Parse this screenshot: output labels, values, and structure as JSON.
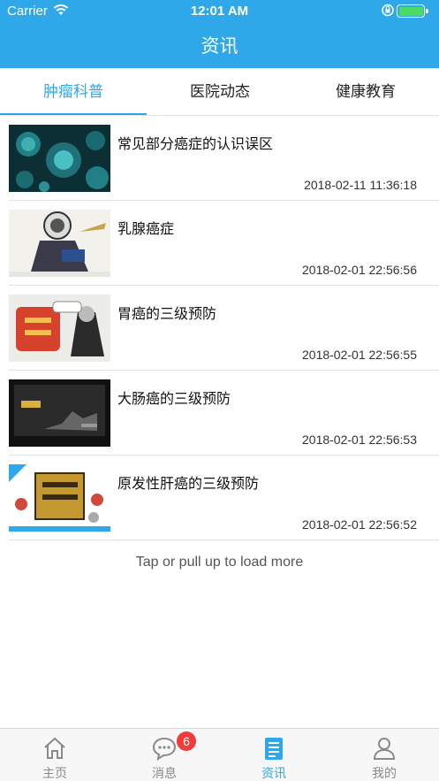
{
  "status_bar": {
    "carrier": "Carrier",
    "time": "12:01 AM"
  },
  "header": {
    "title": "资讯"
  },
  "tabs": [
    {
      "label": "肿瘤科普",
      "active": true
    },
    {
      "label": "医院动态",
      "active": false
    },
    {
      "label": "健康教育",
      "active": false
    }
  ],
  "articles": [
    {
      "title": "常见部分癌症的认识误区",
      "date": "2018-02-11 11:36:18",
      "thumb": "virus-cells-image"
    },
    {
      "title": "乳腺癌症",
      "date": "2018-02-01 22:56:56",
      "thumb": "cartoon-illustration-image"
    },
    {
      "title": "胃癌的三级预防",
      "date": "2018-02-01 22:56:55",
      "thumb": "cancer-character-cartoon-image"
    },
    {
      "title": "大肠癌的三级预防",
      "date": "2018-02-01 22:56:53",
      "thumb": "dark-poster-image"
    },
    {
      "title": "原发性肝癌的三级预防",
      "date": "2018-02-01 22:56:52",
      "thumb": "cancer-word-cartoon-image"
    }
  ],
  "load_more": "Tap or pull up to load more",
  "tabbar": {
    "items": [
      {
        "label": "主页",
        "icon": "home-icon",
        "active": false
      },
      {
        "label": "消息",
        "icon": "chat-bubble-icon",
        "active": false,
        "badge": "6"
      },
      {
        "label": "资讯",
        "icon": "news-doc-icon",
        "active": true
      },
      {
        "label": "我的",
        "icon": "user-icon",
        "active": false
      }
    ]
  },
  "colors": {
    "accent": "#2fa8ea",
    "badge": "#f23b3b",
    "battery": "#4cd964"
  }
}
